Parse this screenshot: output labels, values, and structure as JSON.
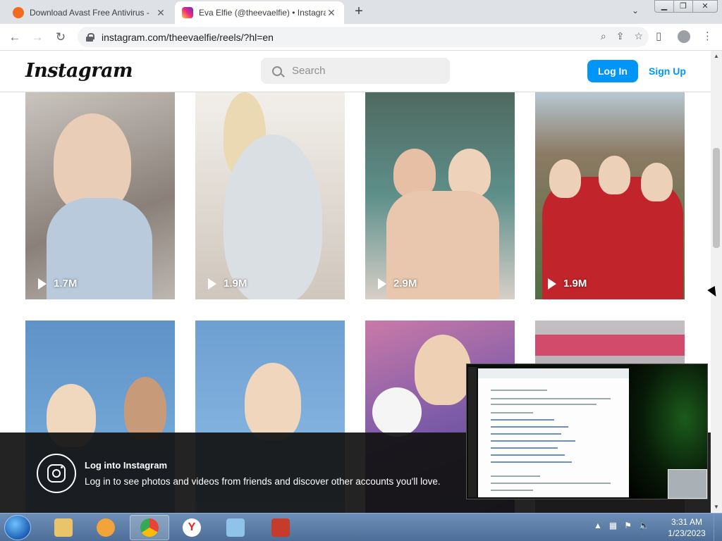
{
  "browser": {
    "tabs": [
      {
        "title": "Download Avast Free Antivirus - ",
        "favicon_color": "#f36b21"
      },
      {
        "title": "Eva Elfie (@theevaelfie) • Instagra",
        "favicon_color": "#d6249f"
      }
    ],
    "new_tab_symbol": "+",
    "url": "instagram.com/theevaelfie/reels/?hl=en"
  },
  "instagram": {
    "logo": "Instagram",
    "search_placeholder": "Search",
    "login_label": "Log In",
    "signup_label": "Sign Up",
    "reels": [
      {
        "views": "1.7M"
      },
      {
        "views": "1.9M"
      },
      {
        "views": "2.9M"
      },
      {
        "views": "1.9M"
      },
      {
        "views": ""
      },
      {
        "views": ""
      },
      {
        "views": ""
      },
      {
        "views": ""
      }
    ],
    "banner": {
      "heading": "Log into Instagram",
      "text": "Log in to see photos and videos from friends and discover other accounts you'll love."
    }
  },
  "taskbar": {
    "time": "3:31 AM",
    "date": "1/23/2023"
  },
  "colors": {
    "accent": "#0095f6"
  }
}
